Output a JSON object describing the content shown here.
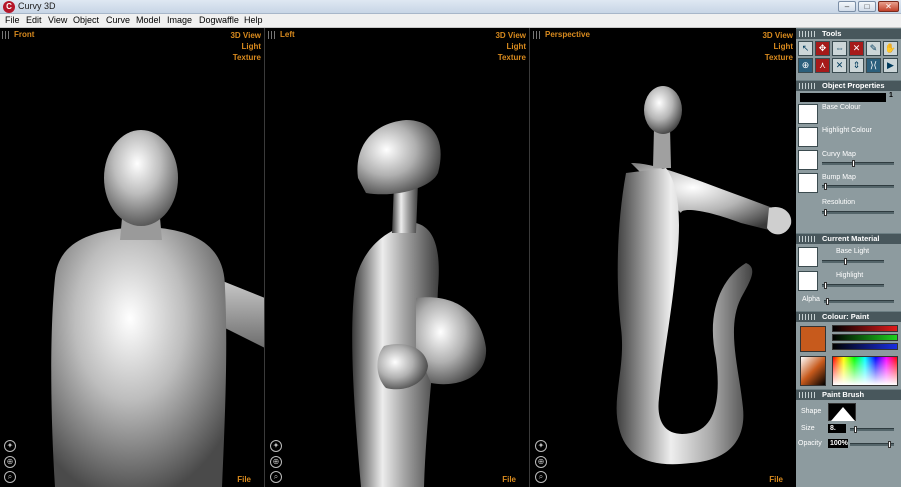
{
  "window": {
    "title": "Curvy 3D",
    "buttons": {
      "minimize": "–",
      "maximize": "□",
      "close": "✕"
    }
  },
  "menu": [
    "File",
    "Edit",
    "View",
    "Object",
    "Curve",
    "Model",
    "Image",
    "Dogwaffle",
    "Help"
  ],
  "viewports": [
    {
      "title": "Front",
      "options": [
        "3D View",
        "Light",
        "Texture"
      ],
      "file": "File"
    },
    {
      "title": "Left",
      "options": [
        "3D View",
        "Light",
        "Texture"
      ],
      "file": "File"
    },
    {
      "title": "Perspective",
      "options": [
        "3D View",
        "Light",
        "Texture"
      ],
      "file": "File"
    }
  ],
  "panels": {
    "tools": {
      "title": "Tools"
    },
    "object_properties": {
      "title": "Object Properties",
      "selection_index": "1",
      "maps": [
        "Base Colour",
        "Highlight Colour",
        "Curvy Map",
        "Bump Map"
      ],
      "resolution_label": "Resolution"
    },
    "current_material": {
      "title": "Current Material",
      "base_light": "Base Light",
      "highlight": "Highlight",
      "alpha": "Alpha"
    },
    "colour": {
      "title": "Colour: Paint",
      "swatch": "#c75a1c"
    },
    "paint_brush": {
      "title": "Paint Brush",
      "shape_label": "Shape",
      "size_label": "Size",
      "size_value": "8.",
      "opacity_label": "Opacity",
      "opacity_value": "100%"
    }
  },
  "colors": {
    "accent": "#d88a1e",
    "panel": "#8d9b9f",
    "panel_title": "#48575c"
  }
}
